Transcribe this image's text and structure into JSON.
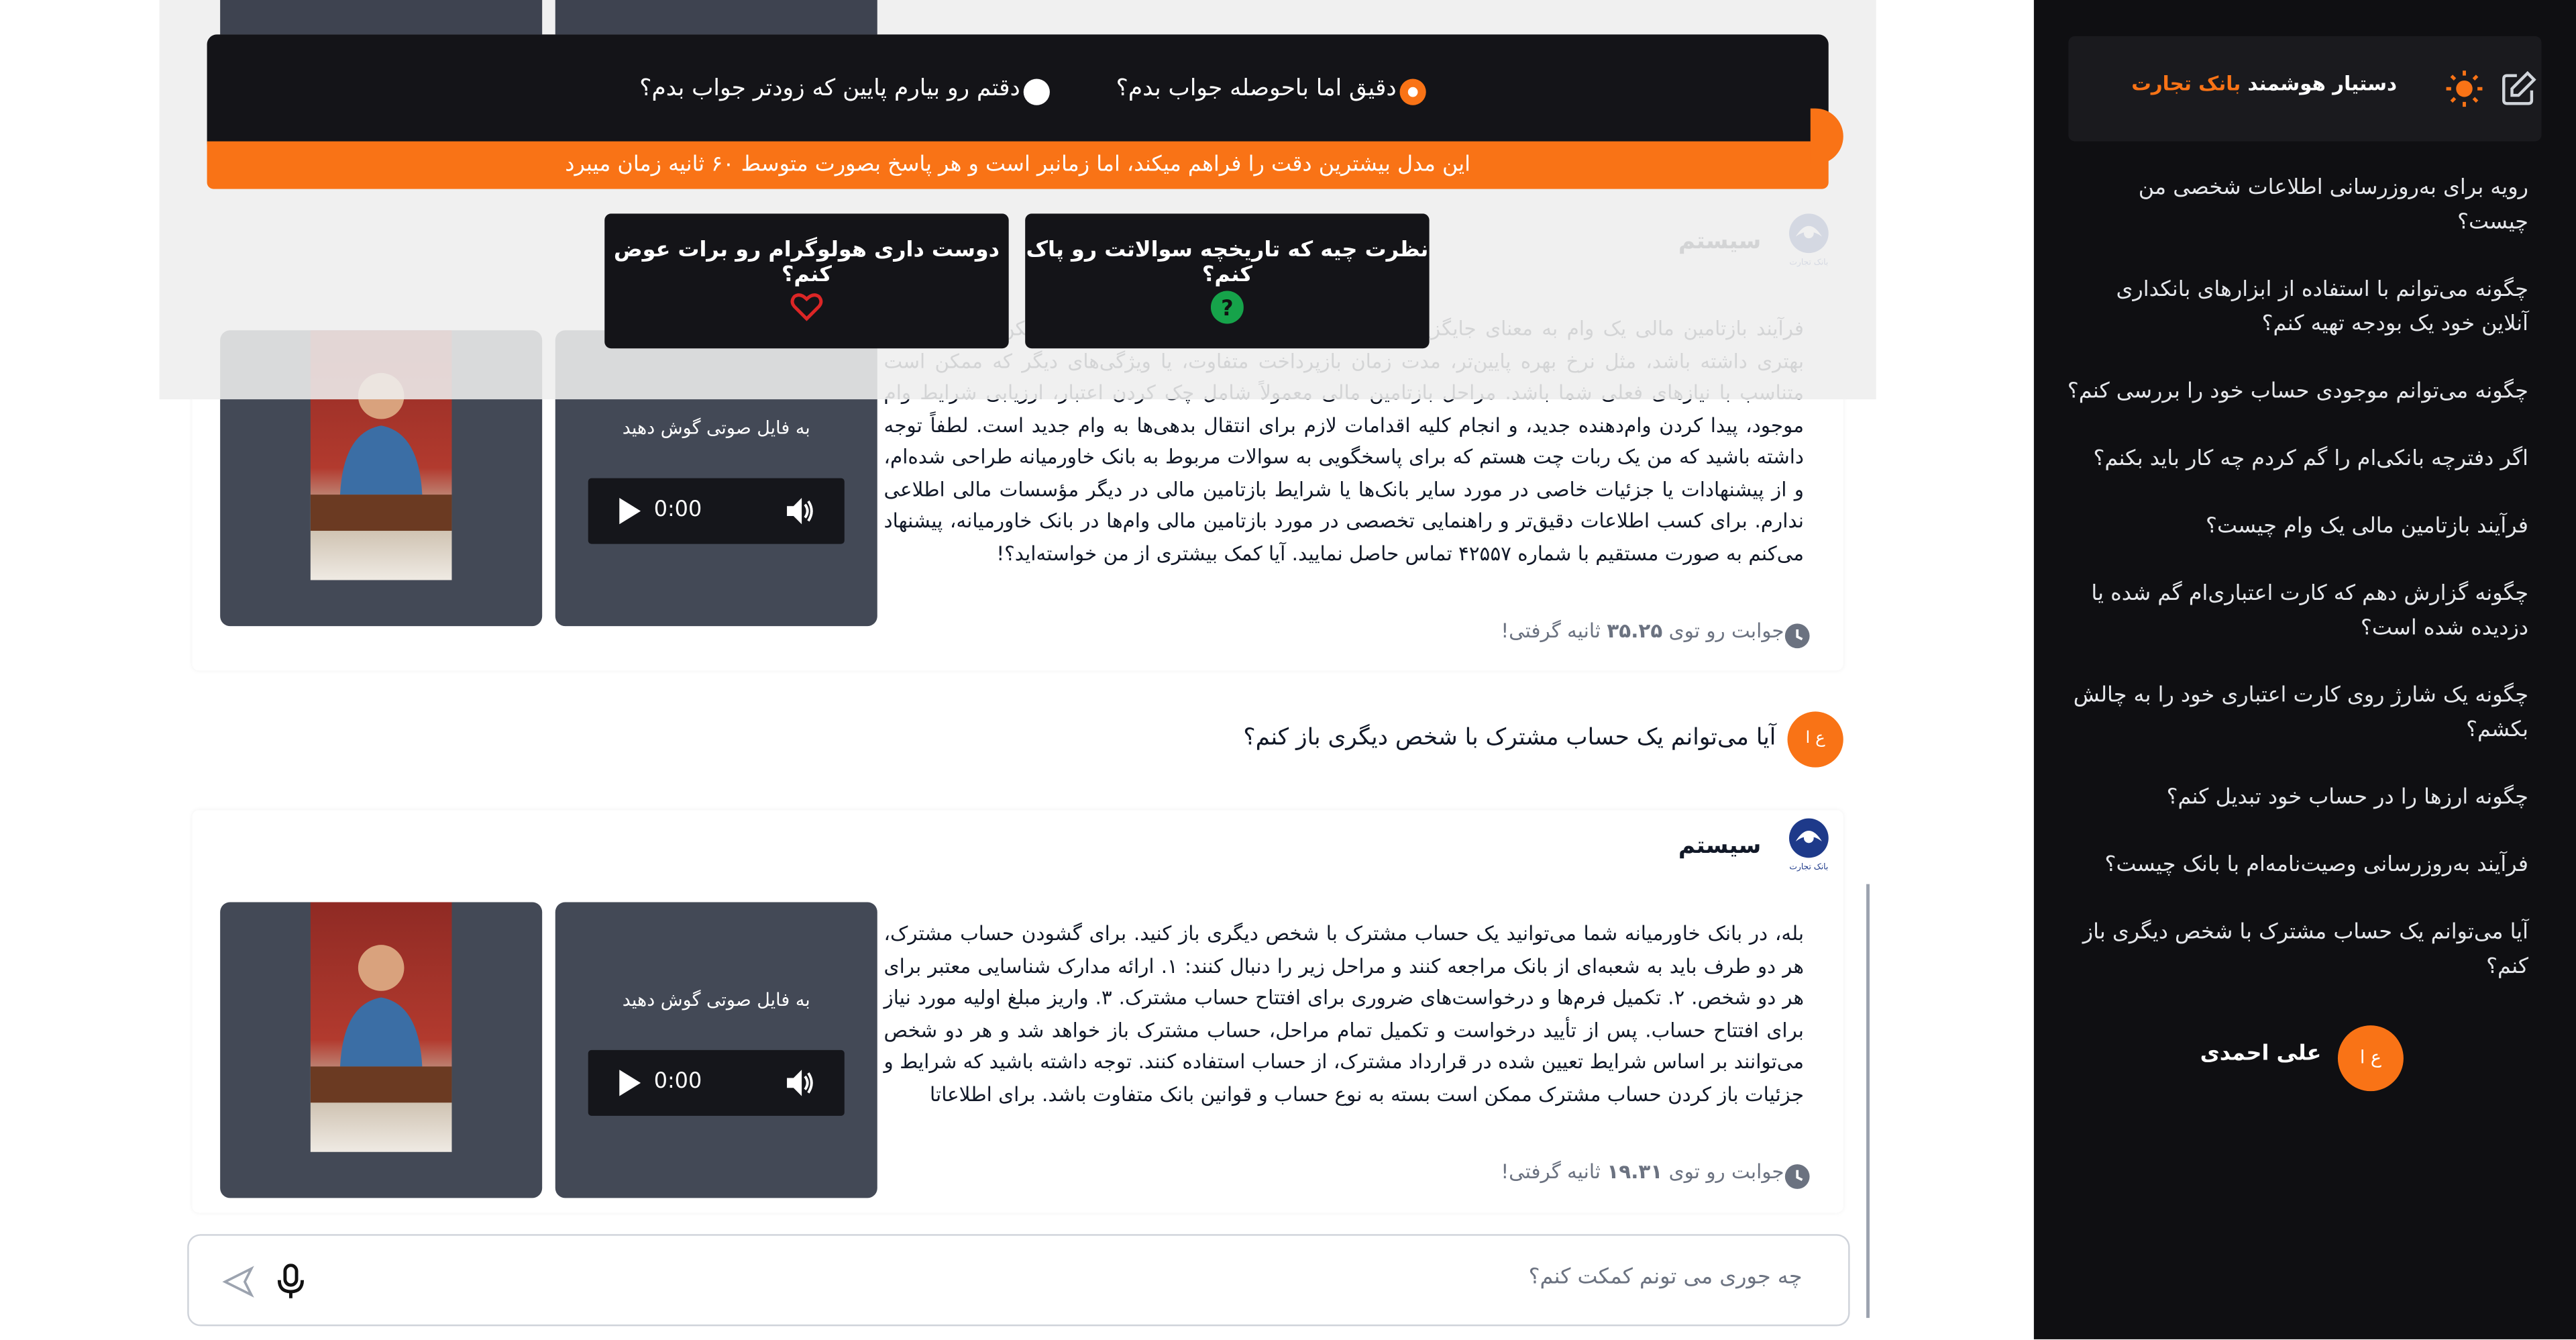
{
  "sidebar": {
    "title_prefix": "دستیار هوشمند ",
    "title_brand": "بانک تجارت",
    "history": [
      "رویه برای به‌روزرسانی اطلاعات شخصی من چیست؟",
      "چگونه می‌توانم با استفاده از ابزارهای بانکداری آنلاین خود یک بودجه تهیه کنم؟",
      "چگونه می‌توانم موجودی حساب خود را بررسی کنم؟",
      "اگر دفترچه بانکی‌ام را گم کردم چه کار باید بکنم؟",
      "فرآیند بازتامین مالی یک وام چیست؟",
      "چگونه گزارش دهم که کارت اعتباری‌ام گم شده یا دزدیده شده است؟",
      "چگونه یک شارژ روی کارت اعتباری خود را به چالش بکشم؟",
      "چگونه ارزها را در حساب خود تبدیل کنم؟",
      "فرآیند به‌روزرسانی وصیت‌نامه‌ام با بانک چیست؟",
      "آیا می‌توانم یک حساب مشترک با شخص دیگری باز کنم؟"
    ],
    "user_initials": "ع ا",
    "user_name": "علی احمدی"
  },
  "overlay": {
    "mode_accurate": "دقیق اما باحوصله جواب بدم؟",
    "mode_fast": "دقتم رو بیارم پایین که زودتر جواب بدم؟",
    "notice": "این مدل بیشترین دقت را فراهم میکند، اما زمانبر است و هر پاسخ بصورت متوسط ۶۰ ثانیه زمان میبرد",
    "tip_clear": "نظرت چیه که تاریخچه سوالاتت رو پاک کنم؟",
    "tip_hologram": "دوست داری هولوگرام رو برات عوض کنم؟"
  },
  "messages": {
    "system_label": "سیستم",
    "bank_logo_text": "بانک تجارت",
    "audio_label": "به فایل صوتی گوش دهید",
    "audio_time": "0:00",
    "answer1": {
      "text": "فرآیند بازتامین مالی یک وام به معنای جایگزینی وام فعلی شما با یک وام جدید است که ممکن است شرایط بهتری داشته باشد، مثل نرخ بهره پایین‌تر، مدت زمان بازپرداخت متفاوت، یا ویژگی‌های دیگر که ممکن است متناسب با نیازهای فعلی شما باشد. مراحل بازتامین مالی معمولاً شامل چک کردن اعتبار، ارزیابی شرایط وام موجود، پیدا کردن وام‌دهنده جدید، و انجام کلیه اقدامات لازم برای انتقال بدهی‌ها به وام جدید است. لطفاً توجه داشته باشید که من یک ربات چت هستم که برای پاسخگویی به سوالات مربوط به بانک خاورمیانه طراحی شده‌ام، و از پیشنهادات یا جزئیات خاصی در مورد سایر بانک‌ها یا شرایط بازتامین مالی در دیگر مؤسسات مالی اطلاعی ندارم. برای کسب اطلاعات دقیق‌تر و راهنمایی تخصصی در مورد بازتامین مالی وام‌ها در بانک خاورمیانه، پیشنهاد می‌کنم به صورت مستقیم با شماره ۴۲۵۵۷ تماس حاصل نمایید. آیا کمک بیشتری از من خواسته‌اید؟!",
      "time_prefix": "جوابت رو توی ",
      "time_value": "۳۵.۲۵",
      "time_suffix": " ثانیه گرفتی!"
    },
    "user_question": "آیا می‌توانم یک حساب مشترک با شخص دیگری باز کنم؟",
    "answer2": {
      "text": "بله، در بانک خاورمیانه شما می‌توانید یک حساب مشترک با شخص دیگری باز کنید. برای گشودن حساب مشترک، هر دو طرف باید به شعبه‌ای از بانک مراجعه کنند و مراحل زیر را دنبال کنند: ۱. ارائه مدارک شناسایی معتبر برای هر دو شخص. ۲. تکمیل فرم‌ها و درخواست‌های ضروری برای افتتاح حساب مشترک. ۳. واریز مبلغ اولیه مورد نیاز برای افتتاح حساب. پس از تأیید درخواست و تکمیل تمام مراحل، حساب مشترک باز خواهد شد و هر دو شخص می‌توانند بر اساس شرایط تعیین شده در قرارداد مشترک، از حساب استفاده کنند. توجه داشته باشید که شرایط و جزئیات باز کردن حساب مشترک ممکن است بسته به نوع حساب و قوانین بانک متفاوت باشد. برای اطلاعاتا",
      "time_prefix": "جوابت رو توی ",
      "time_value": "۱۹.۳۱",
      "time_suffix": " ثانیه گرفتی!"
    }
  },
  "input": {
    "placeholder": "چه جوری می تونم کمکت کنم؟"
  },
  "colors": {
    "accent": "#f97316",
    "sidebar_bg": "#0f0f12",
    "media_bg": "#434956"
  }
}
